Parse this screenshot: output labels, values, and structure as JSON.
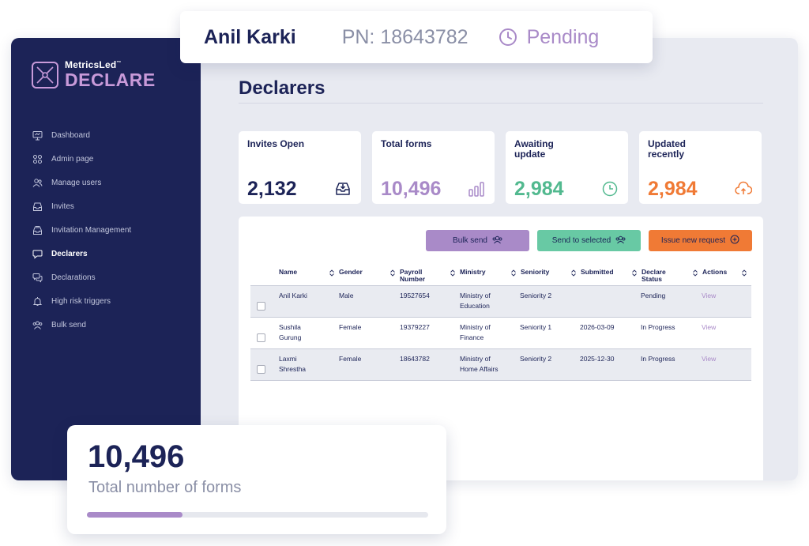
{
  "brand": {
    "small": "MetricsLed",
    "trademark": "™",
    "big": "DECLARE"
  },
  "sidebar": {
    "items": [
      {
        "label": "Dashboard",
        "icon": "monitor-icon",
        "active": false
      },
      {
        "label": "Admin page",
        "icon": "grid-icon",
        "active": false
      },
      {
        "label": "Manage users",
        "icon": "users-icon",
        "active": false
      },
      {
        "label": "Invites",
        "icon": "inbox-icon",
        "active": false
      },
      {
        "label": "Invitation Management",
        "icon": "inbox-stack-icon",
        "active": false
      },
      {
        "label": "Declarers",
        "icon": "chat-icon",
        "active": true
      },
      {
        "label": "Declarations",
        "icon": "chat-bubbles-icon",
        "active": false
      },
      {
        "label": "High risk triggers",
        "icon": "bell-icon",
        "active": false
      },
      {
        "label": "Bulk send",
        "icon": "group-icon",
        "active": false
      }
    ]
  },
  "page": {
    "title": "Declarers"
  },
  "cards": [
    {
      "label": "Invites Open",
      "value": "2,132",
      "color": "#1c2357",
      "icon": "inbox-download-icon"
    },
    {
      "label": "Total forms",
      "value": "10,496",
      "color": "#a98ac8",
      "icon": "bar-chart-icon"
    },
    {
      "label": "Awaiting update",
      "value": "2,984",
      "color": "#52b98f",
      "icon": "clock-icon"
    },
    {
      "label": "Updated recently",
      "value": "2,984",
      "color": "#f07a35",
      "icon": "cloud-upload-icon"
    }
  ],
  "actions": {
    "bulk_send": "Bulk send",
    "send_selected": "Send to selected",
    "issue_request": "Issue new request"
  },
  "table": {
    "headers": [
      "Name",
      "Gender",
      "Payroll Number",
      "Ministry",
      "Seniority",
      "Submitted",
      "Declare Status",
      "Actions"
    ],
    "rows": [
      {
        "name": "Anil Karki",
        "gender": "Male",
        "payroll": "19527654",
        "ministry": "Ministry of Education",
        "seniority": "Seniority 2",
        "submitted": "",
        "status": "Pending",
        "action": "View"
      },
      {
        "name": "Sushila Gurung",
        "gender": "Female",
        "payroll": "19379227",
        "ministry": "Ministry of Finance",
        "seniority": "Seniority 1",
        "submitted": "2026-03-09",
        "status": "In Progress",
        "action": "View"
      },
      {
        "name": "Laxmi Shrestha",
        "gender": "Female",
        "payroll": "18643782",
        "ministry": "Ministry of Home Affairs",
        "seniority": "Seniority 2",
        "submitted": "2025-12-30",
        "status": "In Progress",
        "action": "View"
      }
    ]
  },
  "highlight": {
    "name": "Anil Karki",
    "pn": "PN: 18643782",
    "status": "Pending"
  },
  "summary": {
    "value": "10,496",
    "label": "Total number of forms",
    "progress": 0.28
  },
  "colors": {
    "navy": "#1c2357",
    "purple": "#a98ac8",
    "green": "#68c9a4",
    "orange": "#f07a35"
  }
}
